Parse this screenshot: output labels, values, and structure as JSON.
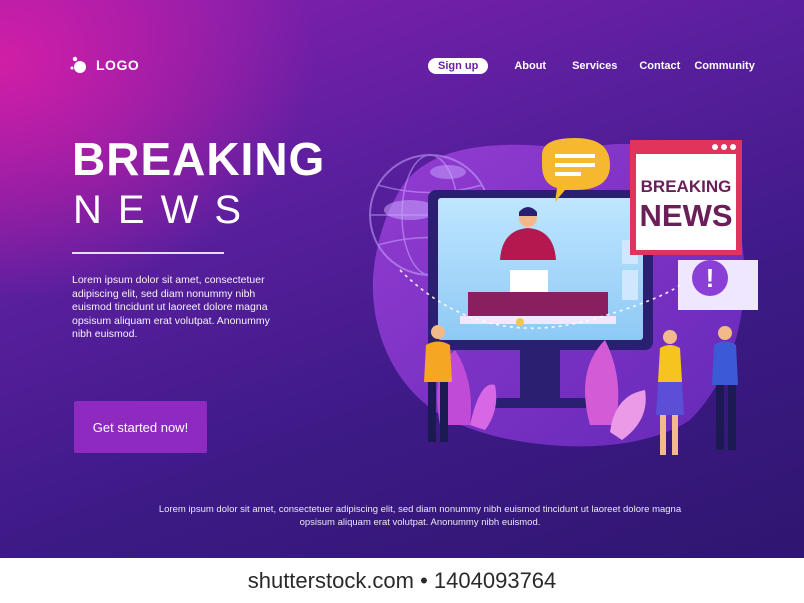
{
  "header": {
    "logo_label": "LOGO",
    "nav": {
      "signup": "Sign up",
      "about": "About",
      "services": "Services",
      "contact": "Contact",
      "community": "Community"
    }
  },
  "hero": {
    "title_line1": "BREAKING",
    "title_line2": "NEWS",
    "body": "Lorem ipsum dolor sit amet, consectetuer adipiscing elit, sed diam nonummy nibh euismod tincidunt ut laoreet dolore magna opsisum aliquam erat volutpat. Anonummy nibh euismod.",
    "cta_label": "Get started now!"
  },
  "illustration": {
    "sign_line1": "BREAKING",
    "sign_line2": "NEWS"
  },
  "footer": {
    "text": "Lorem ipsum dolor sit amet, consectetuer adipiscing elit, sed diam nonummy nibh euismod tincidunt ut laoreet dolore magna opsisum aliquam erat volutpat. Anonummy nibh euismod."
  },
  "watermark": "shutterstock.com • 1404093764",
  "colors": {
    "bg_dark": "#3d1a86",
    "bg_magenta": "#d11ea6",
    "button": "#8e2ac0",
    "sign_red": "#e0345c"
  }
}
